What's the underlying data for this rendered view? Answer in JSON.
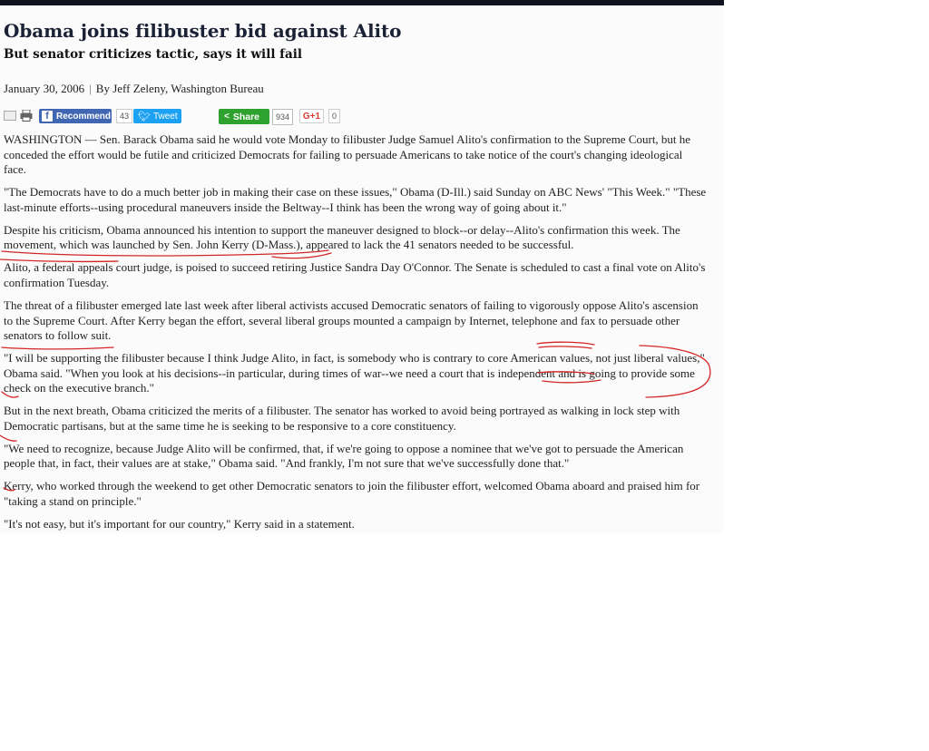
{
  "headline": "Obama joins filibuster bid against Alito",
  "subheadline": "But senator criticizes tactic, says it will fail",
  "byline": {
    "date": "January 30, 2006",
    "separator": "|",
    "author": "By Jeff Zeleny, Washington Bureau"
  },
  "share_bar": {
    "facebook_label": "Recommend",
    "facebook_count": "43",
    "twitter_label": "Tweet",
    "share_label": "Share",
    "share_count": "934",
    "gplus_label": "G+1",
    "gplus_count": "0",
    "icons": [
      "email-icon",
      "print-icon",
      "facebook-icon",
      "twitter-bird-icon",
      "share-icon"
    ]
  },
  "paragraphs": [
    "WASHINGTON — Sen. Barack Obama said he would vote Monday to filibuster Judge Samuel Alito's confirmation to the Supreme Court, but he conceded the effort would be futile and criticized Democrats for failing to persuade Americans to take notice of the court's changing ideological face.",
    "\"The Democrats have to do a much better job in making their case on these issues,\" Obama (D-Ill.) said Sunday on ABC News' \"This Week.\" \"These last-minute efforts--using procedural maneuvers inside the Beltway--I think has been the wrong way of going about it.\"",
    "Despite his criticism, Obama announced his intention to support the maneuver designed to block--or delay--Alito's confirmation this week. The movement, which was launched by Sen. John Kerry (D-Mass.), appeared to lack the 41 senators needed to be successful.",
    "Alito, a federal appeals court judge, is poised to succeed retiring Justice Sandra Day O'Connor. The Senate is scheduled to cast a final vote on Alito's confirmation Tuesday.",
    "The threat of a filibuster emerged late last week after liberal activists accused Democratic senators of failing to vigorously oppose Alito's ascension to the Supreme Court. After Kerry began the effort, several liberal groups mounted a campaign by Internet, telephone and fax to persuade other senators to follow suit.",
    "\"I will be supporting the filibuster because I think Judge Alito, in fact, is somebody who is contrary to core American values, not just liberal values,\" Obama said. \"When you look at his decisions--in particular, during times of war--we need a court that is independent and is going to provide some check on the executive branch.\"",
    "But in the next breath, Obama criticized the merits of a filibuster. The senator has worked to avoid being portrayed as walking in lock step with Democratic partisans, but at the same time he is seeking to be responsive to a core constituency.",
    "\"We need to recognize, because Judge Alito will be confirmed, that, if we're going to oppose a nominee that we've got to persuade the American people that, in fact, their values are at stake,\" Obama said. \"And frankly, I'm not sure that we've successfully done that.\"",
    "Kerry, who worked through the weekend to get other Democratic senators to join the filibuster effort, welcomed Obama aboard and praised him for \"taking a stand on principle.\"",
    "\"It's not easy, but it's important for our country,\" Kerry said in a statement."
  ],
  "colors": {
    "top_bar": "#10131f",
    "headline": "#1b2236",
    "annotation_ink": "#d32626",
    "facebook": "#4267b2",
    "twitter": "#1da1f2",
    "share": "#2ea12e"
  }
}
